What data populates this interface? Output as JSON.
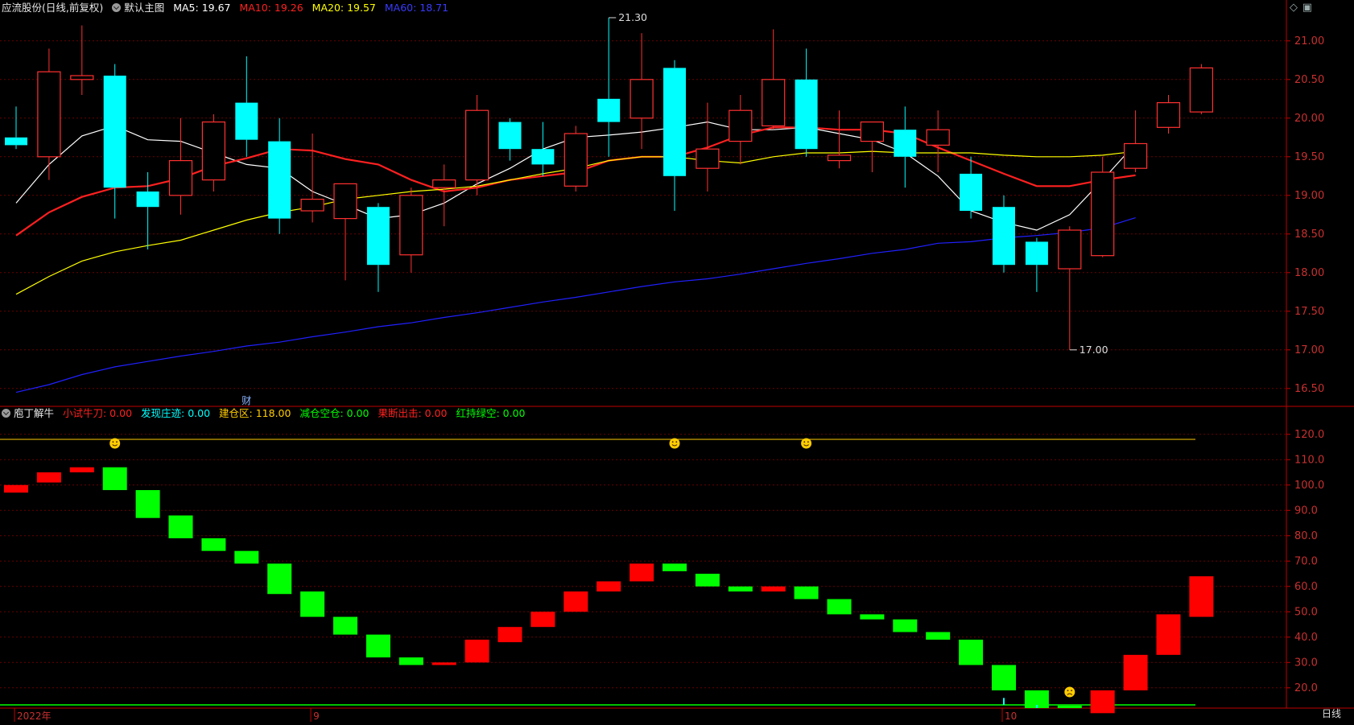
{
  "header": {
    "stock": "应流股份(日线,前复权)",
    "main_label": "默认主图",
    "ma": [
      {
        "label": "MA5: 19.67",
        "color": "#ffffff"
      },
      {
        "label": "MA10: 19.26",
        "color": "#ff2020"
      },
      {
        "label": "MA20: 19.57",
        "color": "#ffff00"
      },
      {
        "label": "MA60: 18.71",
        "color": "#2020ff"
      }
    ]
  },
  "sub_header": {
    "name": "庖丁解牛",
    "items": [
      {
        "label": "小试牛刀: 0.00",
        "color": "#ff2020"
      },
      {
        "label": "发现庄迹: 0.00",
        "color": "#00ffff"
      },
      {
        "label": "建仓区: 118.00",
        "color": "#ffcc00"
      },
      {
        "label": "减仓空仓: 0.00",
        "color": "#00ff00"
      },
      {
        "label": "果断出击: 0.00",
        "color": "#ff2020"
      },
      {
        "label": "红持绿空: 0.00",
        "color": "#00ff00"
      }
    ]
  },
  "corner_icons": [
    "diamond-icon",
    "window-restore-icon"
  ],
  "bottom": {
    "period": "日线"
  },
  "colors": {
    "up": "#ff3030",
    "down": "#00ffff",
    "bg": "#000000",
    "grid": "#6a0000",
    "axis": "#c00000",
    "green_bar": "#00ff00",
    "red_bar": "#ff0000",
    "ma5": "#ffffff",
    "ma10": "#ff2020",
    "ma20": "#ffff00",
    "ma60": "#2020ff",
    "line_yellow": "#ffcc00"
  },
  "chart_data": [
    {
      "type": "candlestick",
      "title": "应流股份(日线,前复权)",
      "ylim": [
        16.3,
        21.3
      ],
      "y_ticks": [
        "21.00",
        "20.50",
        "20.00",
        "19.50",
        "19.00",
        "18.50",
        "18.00",
        "17.50",
        "17.00",
        "16.50"
      ],
      "x_labels": [
        {
          "i": 0,
          "text": "2022年"
        },
        {
          "i": 9,
          "text": "9"
        },
        {
          "i": 30,
          "text": "10"
        }
      ],
      "candles": [
        {
          "o": 19.75,
          "h": 20.15,
          "l": 19.6,
          "c": 19.65
        },
        {
          "o": 19.5,
          "h": 20.9,
          "l": 19.2,
          "c": 20.6
        },
        {
          "o": 20.5,
          "h": 21.2,
          "l": 20.3,
          "c": 20.55
        },
        {
          "o": 20.55,
          "h": 20.7,
          "l": 18.7,
          "c": 19.1
        },
        {
          "o": 19.05,
          "h": 19.3,
          "l": 18.3,
          "c": 18.85
        },
        {
          "o": 19.0,
          "h": 20.0,
          "l": 18.75,
          "c": 19.45
        },
        {
          "o": 19.2,
          "h": 20.05,
          "l": 19.05,
          "c": 19.95
        },
        {
          "o": 20.2,
          "h": 20.8,
          "l": 19.5,
          "c": 19.72
        },
        {
          "o": 19.7,
          "h": 20.0,
          "l": 18.5,
          "c": 18.7
        },
        {
          "o": 18.8,
          "h": 19.8,
          "l": 18.65,
          "c": 18.95
        },
        {
          "o": 18.7,
          "h": 19.1,
          "l": 17.9,
          "c": 19.15
        },
        {
          "o": 18.85,
          "h": 18.9,
          "l": 17.75,
          "c": 18.1
        },
        {
          "o": 18.23,
          "h": 19.1,
          "l": 18.0,
          "c": 19.0
        },
        {
          "o": 19.1,
          "h": 19.4,
          "l": 18.6,
          "c": 19.2
        },
        {
          "o": 19.2,
          "h": 20.3,
          "l": 19.0,
          "c": 20.1
        },
        {
          "o": 19.95,
          "h": 20.0,
          "l": 19.45,
          "c": 19.6
        },
        {
          "o": 19.6,
          "h": 19.95,
          "l": 19.25,
          "c": 19.4
        },
        {
          "o": 19.12,
          "h": 19.9,
          "l": 19.05,
          "c": 19.8
        },
        {
          "o": 20.25,
          "h": 21.3,
          "l": 19.5,
          "c": 19.95
        },
        {
          "o": 20.0,
          "h": 21.1,
          "l": 19.6,
          "c": 20.5
        },
        {
          "o": 20.65,
          "h": 20.75,
          "l": 18.8,
          "c": 19.25
        },
        {
          "o": 19.35,
          "h": 20.2,
          "l": 19.05,
          "c": 19.6
        },
        {
          "o": 19.7,
          "h": 20.3,
          "l": 19.4,
          "c": 20.1
        },
        {
          "o": 19.9,
          "h": 21.15,
          "l": 19.85,
          "c": 20.5
        },
        {
          "o": 20.5,
          "h": 20.9,
          "l": 19.5,
          "c": 19.6
        },
        {
          "o": 19.45,
          "h": 20.1,
          "l": 19.35,
          "c": 19.52
        },
        {
          "o": 19.7,
          "h": 19.95,
          "l": 19.3,
          "c": 19.95
        },
        {
          "o": 19.85,
          "h": 20.15,
          "l": 19.1,
          "c": 19.5
        },
        {
          "o": 19.65,
          "h": 20.1,
          "l": 19.3,
          "c": 19.85
        },
        {
          "o": 19.28,
          "h": 19.5,
          "l": 18.7,
          "c": 18.8
        },
        {
          "o": 18.85,
          "h": 19.0,
          "l": 18.0,
          "c": 18.1
        },
        {
          "o": 18.4,
          "h": 18.45,
          "l": 17.75,
          "c": 18.1
        },
        {
          "o": 18.05,
          "h": 18.6,
          "l": 17.0,
          "c": 18.55
        },
        {
          "o": 18.22,
          "h": 19.5,
          "l": 18.2,
          "c": 19.3
        },
        {
          "o": 19.35,
          "h": 20.1,
          "l": 19.3,
          "c": 19.67
        },
        {
          "o": 19.88,
          "h": 20.3,
          "l": 19.8,
          "c": 20.2
        },
        {
          "o": 20.08,
          "h": 20.7,
          "l": 20.05,
          "c": 20.65
        }
      ],
      "series": [
        {
          "name": "MA5",
          "values": [
            18.9,
            19.4,
            19.77,
            19.9,
            19.72,
            19.7,
            19.55,
            19.4,
            19.35,
            19.05,
            18.88,
            18.7,
            18.75,
            18.9,
            19.15,
            19.35,
            19.6,
            19.75,
            19.78,
            19.82,
            19.88,
            19.95,
            19.85,
            19.85,
            19.88,
            19.8,
            19.72,
            19.55,
            19.25,
            18.8,
            18.65,
            18.55,
            18.75,
            19.2,
            19.67
          ]
        },
        {
          "name": "MA10",
          "values": [
            18.48,
            18.78,
            18.98,
            19.1,
            19.12,
            19.22,
            19.38,
            19.48,
            19.6,
            19.58,
            19.47,
            19.4,
            19.2,
            19.05,
            19.1,
            19.2,
            19.25,
            19.3,
            19.45,
            19.5,
            19.5,
            19.62,
            19.78,
            19.88,
            19.88,
            19.85,
            19.85,
            19.8,
            19.62,
            19.45,
            19.28,
            19.12,
            19.12,
            19.2,
            19.26
          ]
        },
        {
          "name": "MA20",
          "values": [
            17.72,
            17.95,
            18.15,
            18.27,
            18.35,
            18.42,
            18.55,
            18.68,
            18.78,
            18.85,
            18.95,
            19.0,
            19.05,
            19.08,
            19.12,
            19.2,
            19.28,
            19.35,
            19.45,
            19.5,
            19.5,
            19.45,
            19.42,
            19.5,
            19.55,
            19.55,
            19.57,
            19.55,
            19.55,
            19.55,
            19.52,
            19.5,
            19.5,
            19.52,
            19.57
          ]
        },
        {
          "name": "MA60",
          "values": [
            16.45,
            16.55,
            16.68,
            16.78,
            16.85,
            16.92,
            16.98,
            17.05,
            17.1,
            17.17,
            17.23,
            17.3,
            17.35,
            17.42,
            17.48,
            17.55,
            17.62,
            17.68,
            17.75,
            17.82,
            17.88,
            17.92,
            17.98,
            18.05,
            18.12,
            18.18,
            18.25,
            18.3,
            18.38,
            18.4,
            18.45,
            18.48,
            18.52,
            18.58,
            18.71
          ]
        }
      ],
      "annotations": [
        {
          "i": 18,
          "value": 21.3,
          "text": "21.30"
        },
        {
          "i": 32,
          "value": 17.0,
          "text": "17.00"
        },
        {
          "i": 7,
          "text": "财"
        }
      ]
    },
    {
      "type": "bar",
      "title": "庖丁解牛",
      "ylim": [
        12,
        125
      ],
      "y_ticks": [
        "120.0",
        "110.0",
        "100.0",
        "90.0",
        "80.0",
        "70.0",
        "60.0",
        "50.0",
        "40.0",
        "30.0",
        "20.0"
      ],
      "level_line": 118,
      "bars": [
        {
          "lo": 97,
          "hi": 100,
          "color": "red"
        },
        {
          "lo": 101,
          "hi": 105,
          "color": "red"
        },
        {
          "lo": 105,
          "hi": 107,
          "color": "red"
        },
        {
          "lo": 98,
          "hi": 107,
          "color": "green"
        },
        {
          "lo": 87,
          "hi": 98,
          "color": "green"
        },
        {
          "lo": 79,
          "hi": 88,
          "color": "green"
        },
        {
          "lo": 74,
          "hi": 79,
          "color": "green"
        },
        {
          "lo": 69,
          "hi": 74,
          "color": "green"
        },
        {
          "lo": 57,
          "hi": 69,
          "color": "green"
        },
        {
          "lo": 48,
          "hi": 58,
          "color": "green"
        },
        {
          "lo": 41,
          "hi": 48,
          "color": "green"
        },
        {
          "lo": 32,
          "hi": 41,
          "color": "green"
        },
        {
          "lo": 29,
          "hi": 32,
          "color": "green"
        },
        {
          "lo": 29,
          "hi": 30,
          "color": "red"
        },
        {
          "lo": 30,
          "hi": 39,
          "color": "red"
        },
        {
          "lo": 38,
          "hi": 44,
          "color": "red"
        },
        {
          "lo": 44,
          "hi": 50,
          "color": "red"
        },
        {
          "lo": 50,
          "hi": 58,
          "color": "red"
        },
        {
          "lo": 58,
          "hi": 62,
          "color": "red"
        },
        {
          "lo": 62,
          "hi": 69,
          "color": "red"
        },
        {
          "lo": 66,
          "hi": 69,
          "color": "green"
        },
        {
          "lo": 60,
          "hi": 65,
          "color": "green"
        },
        {
          "lo": 58,
          "hi": 60,
          "color": "green"
        },
        {
          "lo": 58,
          "hi": 60,
          "color": "red"
        },
        {
          "lo": 55,
          "hi": 60,
          "color": "green"
        },
        {
          "lo": 49,
          "hi": 55,
          "color": "green"
        },
        {
          "lo": 47,
          "hi": 49,
          "color": "green"
        },
        {
          "lo": 42,
          "hi": 47,
          "color": "green"
        },
        {
          "lo": 39,
          "hi": 42,
          "color": "green"
        },
        {
          "lo": 29,
          "hi": 39,
          "color": "green"
        },
        {
          "lo": 19,
          "hi": 29,
          "color": "green"
        },
        {
          "lo": 12,
          "hi": 19,
          "color": "green"
        },
        {
          "lo": 12,
          "hi": 13,
          "color": "green"
        },
        {
          "lo": 10,
          "hi": 19,
          "color": "red"
        },
        {
          "lo": 19,
          "hi": 33,
          "color": "red"
        },
        {
          "lo": 33,
          "hi": 49,
          "color": "red"
        },
        {
          "lo": 48,
          "hi": 64,
          "color": "red"
        }
      ],
      "smileys": [
        3,
        20,
        24
      ],
      "frowns": [
        32
      ],
      "cyan_spikes": [
        {
          "i": 30,
          "hi": 16
        },
        {
          "i": 31,
          "hi": 12
        }
      ]
    }
  ]
}
